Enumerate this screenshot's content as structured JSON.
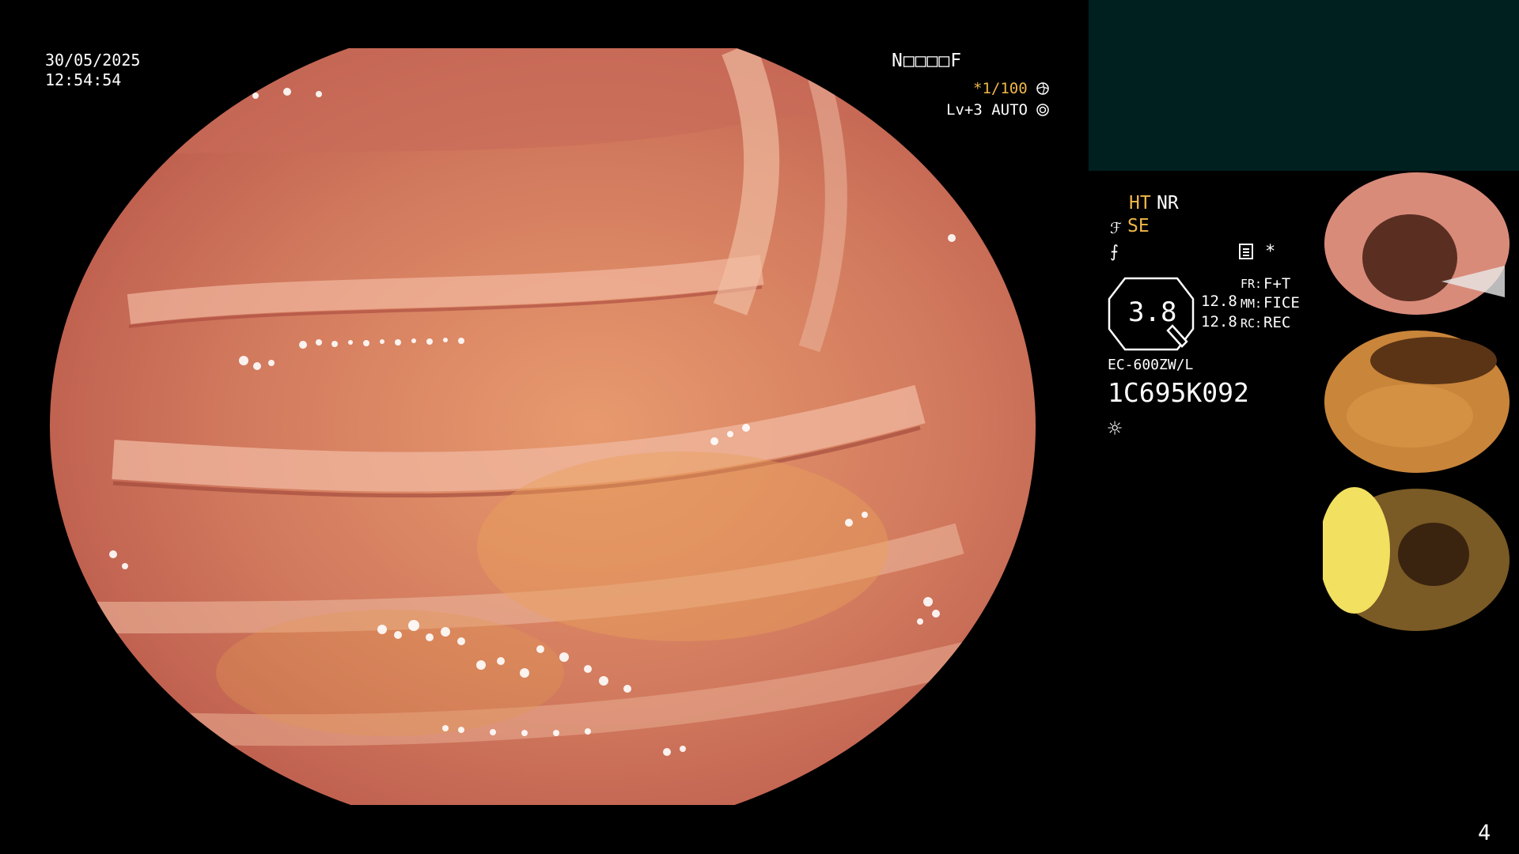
{
  "overlay": {
    "date": "30/05/2025",
    "time": "12:54:54",
    "patient_field": "N□□□□F",
    "zoom": "*1/100",
    "level": "Lv+3 AUTO"
  },
  "settings": {
    "ht": "HT",
    "nr": "NR",
    "se": "SE",
    "star": "*",
    "value": "3.8",
    "row1_num": "12.8",
    "row2_num": "12.8",
    "fr_label": "FR:",
    "fr_value": "F+T",
    "mm_label": "MM:",
    "mm_value": "FICE",
    "rc_label": "RC:",
    "rc_value": "REC",
    "model": "EC-600ZW/L",
    "serial": "1C695K092"
  },
  "footer": {
    "page_number": "4"
  },
  "colors": {
    "accent": "#f0b74a",
    "panel": "#002020",
    "mucosa": "#d0745a"
  },
  "icons": [
    "aperture-icon",
    "iris-icon",
    "scope-icon",
    "slash-icon",
    "document-icon",
    "sun-icon"
  ]
}
